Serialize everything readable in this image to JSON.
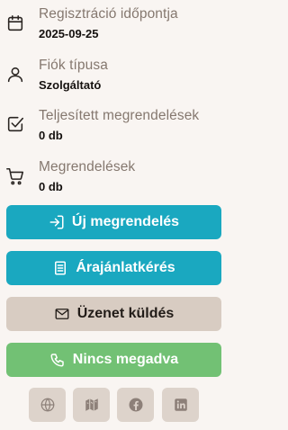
{
  "info": {
    "registration": {
      "label": "Regisztráció időpontja",
      "value": "2025-09-25",
      "icon": "calendar-icon"
    },
    "account_type": {
      "label": "Fiók típusa",
      "value": "Szolgáltató",
      "icon": "user-icon"
    },
    "completed_orders": {
      "label": "Teljesített megrendelések",
      "value": "0 db",
      "icon": "checkbox-icon"
    },
    "orders": {
      "label": "Megrendelések",
      "value": "0 db",
      "icon": "cart-icon"
    }
  },
  "actions": {
    "new_order": {
      "label": "Új megrendelés",
      "icon": "login-icon",
      "color": "#1aa8c0"
    },
    "quote_request": {
      "label": "Árajánlatkérés",
      "icon": "document-icon",
      "color": "#1aa8c0"
    },
    "send_message": {
      "label": "Üzenet küldés",
      "icon": "envelope-icon",
      "color": "#d8ccc2"
    },
    "phone": {
      "label": "Nincs megadva",
      "icon": "phone-icon",
      "color": "#72c174"
    }
  },
  "social": [
    {
      "icon": "globe-icon"
    },
    {
      "icon": "map-icon"
    },
    {
      "icon": "facebook-icon"
    },
    {
      "icon": "linkedin-icon"
    }
  ]
}
